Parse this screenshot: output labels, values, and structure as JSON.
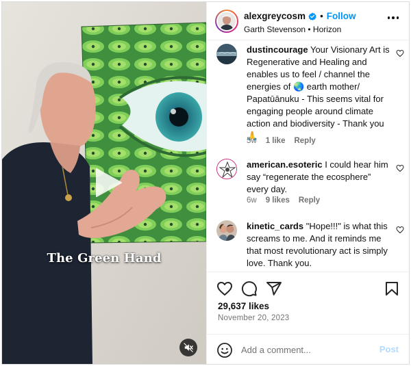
{
  "media": {
    "caption": "The Green Hand",
    "play_icon": "play-icon",
    "mute_icon": "speaker-muted-icon"
  },
  "header": {
    "username": "alexgreycosm",
    "separator": "•",
    "follow_label": "Follow",
    "subline": "Garth Stevenson • Horizon"
  },
  "comments": [
    {
      "username": "dustincourage",
      "text_before": "Your Visionary Art is Regenerative and Healing and enables us to feel / channel the energies of",
      "emoji": "🌏",
      "text_after": "earth mother/ Papatūānuku - This seems vital for engaging people around climate action and biodiversity - Thank you",
      "emoji_end": "🙏",
      "age": "5w",
      "likes": "1 like",
      "reply": "Reply"
    },
    {
      "username": "american.esoteric",
      "text": "I could hear him say “regenerate the ecosphere” every day.",
      "age": "6w",
      "likes": "9 likes",
      "reply": "Reply"
    },
    {
      "username": "kinetic_cards",
      "text": "\"Hope!!!\" is what this screams to me. And it reminds me that most revolutionary act is simply love. Thank you.",
      "age": "",
      "likes": "",
      "reply": ""
    }
  ],
  "actions": {
    "likes": "29,637 likes",
    "date": "November 20, 2023"
  },
  "add_comment": {
    "placeholder": "Add a comment...",
    "post_label": "Post"
  },
  "colors": {
    "accent": "#0095f6",
    "post_disabled": "#b3dbff",
    "painting_green": "#6fc25a",
    "shirt": "#1d2533"
  }
}
